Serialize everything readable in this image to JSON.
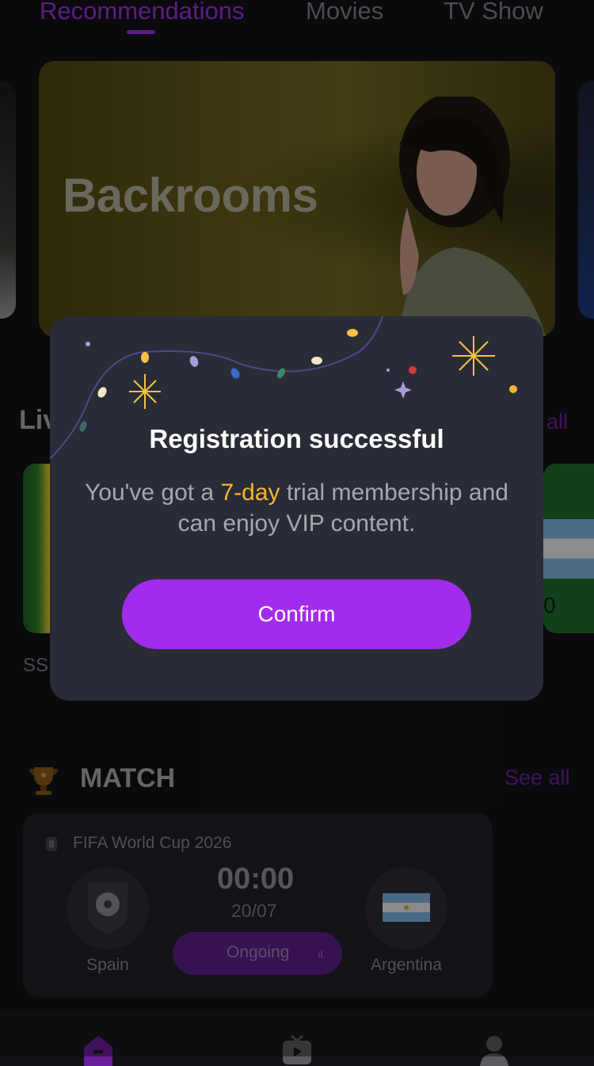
{
  "tabs": [
    {
      "label": "Recommendations",
      "active": true
    },
    {
      "label": "Movies",
      "active": false
    },
    {
      "label": "TV Show",
      "active": false
    }
  ],
  "banner": {
    "title": "Backrooms"
  },
  "live_section": {
    "title": "Liv",
    "see_all": "all",
    "left_card_label": "SS",
    "right_card_digit": "0"
  },
  "match_section": {
    "title": "MATCH",
    "see_all": "See all",
    "card": {
      "league_icon_text": "8",
      "league": "FIFA World Cup 2026",
      "score": "00:00",
      "date": "20/07",
      "status": "Ongoing",
      "status_icon": "ıl.",
      "home_team": "Spain",
      "away_team": "Argentina"
    }
  },
  "bottom_nav": {
    "items": [
      "home-icon",
      "tv-icon",
      "profile-icon"
    ]
  },
  "modal": {
    "title": "Registration successful",
    "body_prefix": "You've got a ",
    "body_highlight": "7-day",
    "body_suffix": " trial membership and can enjoy VIP content.",
    "confirm_label": "Confirm"
  },
  "colors": {
    "accent": "#a22ceb",
    "highlight": "#f5b52c",
    "modal_bg": "#292c36",
    "page_bg": "#121216"
  }
}
